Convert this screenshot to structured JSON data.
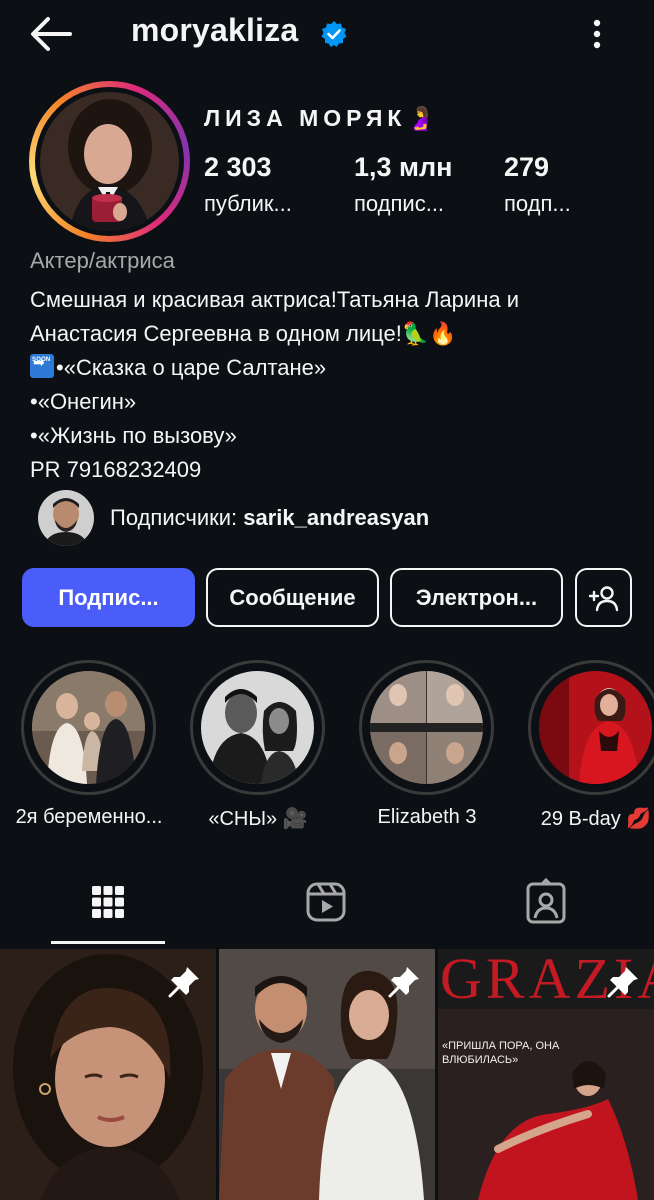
{
  "header": {
    "username": "moryakliza",
    "back_icon": "arrow-left-icon",
    "verified_icon": "verified-badge-icon",
    "more_icon": "kebab-menu-icon"
  },
  "profile": {
    "display_name": "ЛИЗА МОРЯК",
    "display_name_emoji": "🤰",
    "stats": [
      {
        "value": "2 303",
        "label": "публик..."
      },
      {
        "value": "1,3 млн",
        "label": "подпис..."
      },
      {
        "value": "279",
        "label": "подп..."
      }
    ],
    "category": "Актер/актриса",
    "bio_lines": [
      "Смешная и красивая актриса!Татьяна Ларина и",
      "Анастасия Сергеевна в одном лице!🦜🔥",
      "•«Сказка о царе Салтане»",
      "•«Онегин»",
      "•«Жизнь по вызову»",
      "PR 79168232409"
    ],
    "soon_badge": {
      "arrow": "➡",
      "text": "SOON"
    },
    "followed_by_prefix": "Подписчики: ",
    "followed_by_user": "sarik_andreasyan"
  },
  "actions": {
    "follow_label": "Подпис...",
    "message_label": "Сообщение",
    "email_label": "Электрон...",
    "add_user_icon": "add-person-icon"
  },
  "highlights": [
    {
      "label": "2я беременно..."
    },
    {
      "label": "«СНЫ» 🎥"
    },
    {
      "label": "Elizabeth 3"
    },
    {
      "label": "29 B-day 💋"
    }
  ],
  "tabs": [
    {
      "icon": "grid-icon",
      "active": true
    },
    {
      "icon": "reels-icon",
      "active": false
    },
    {
      "icon": "tagged-icon",
      "active": false
    }
  ],
  "posts": [
    {
      "pinned": true
    },
    {
      "pinned": true
    },
    {
      "pinned": true,
      "magazine_title": "GRAZIA",
      "magazine_headline": "«ПРИШЛА ПОРА, ОНА ВЛЮБИЛАСЬ»"
    }
  ],
  "colors": {
    "background": "#0c1014",
    "primary_button": "#4a5df9",
    "verified": "#0095f6",
    "muted_text": "#a8a8a8"
  }
}
